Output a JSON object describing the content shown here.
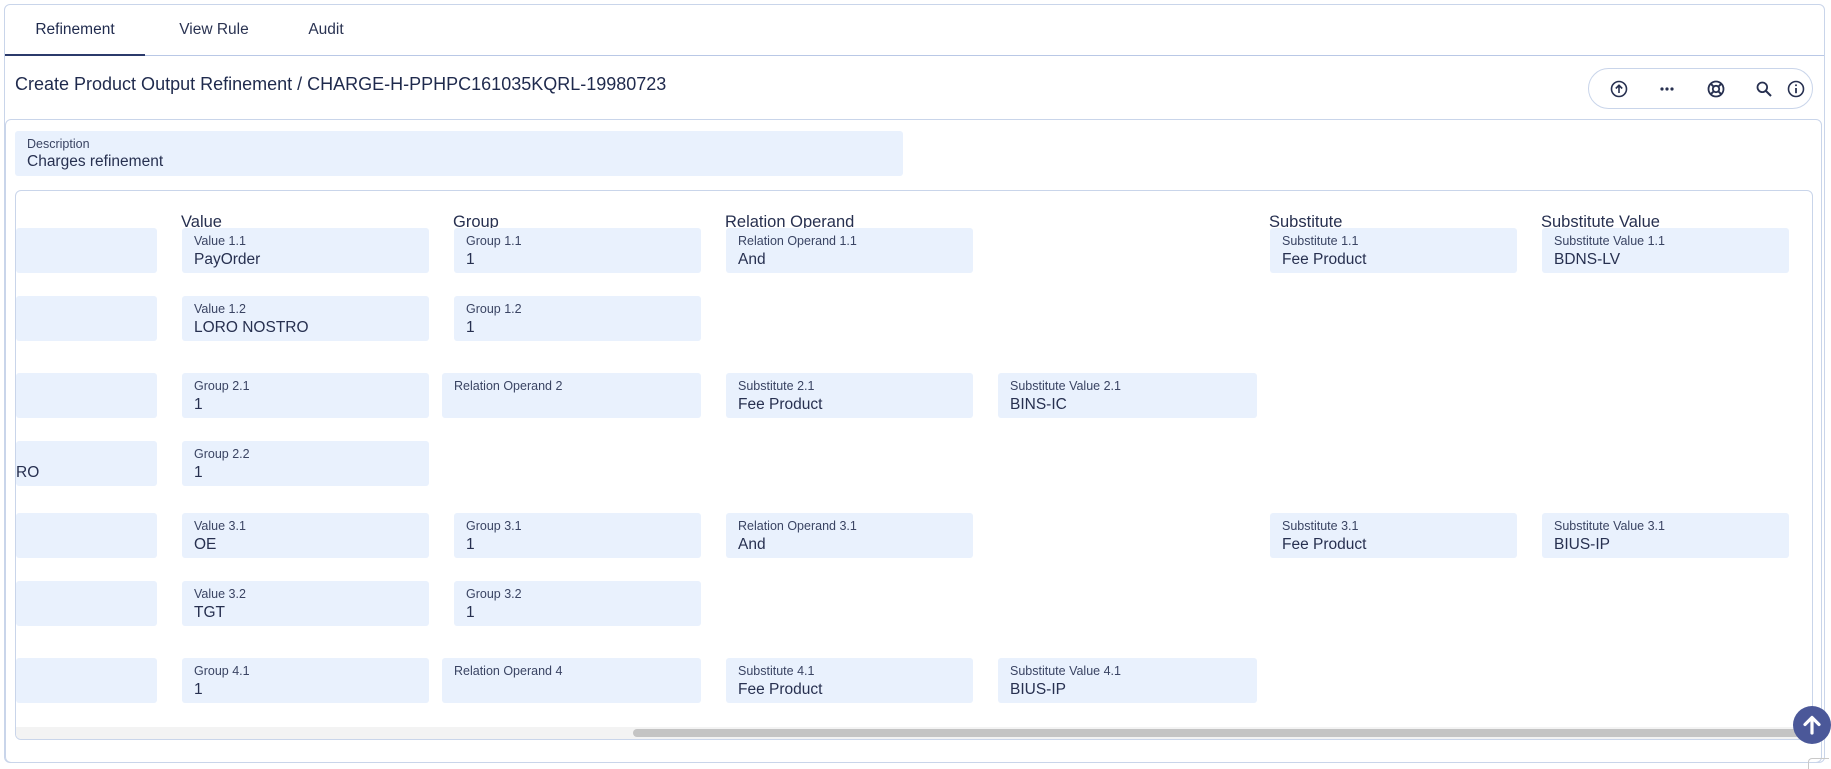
{
  "tabs": [
    {
      "label": "Refinement",
      "active": true
    },
    {
      "label": "View Rule",
      "active": false
    },
    {
      "label": "Audit",
      "active": false
    }
  ],
  "page": {
    "title": "Create Product Output Refinement / CHARGE-H-PPHPC161035KQRL-19980723"
  },
  "toolbar": {
    "icons": [
      "arrow-up-circle-icon",
      "more-horizontal-icon",
      "lifebuoy-icon",
      "search-icon",
      "info-icon"
    ]
  },
  "description": {
    "label": "Description",
    "value": "Charges refinement"
  },
  "grid": {
    "headers": {
      "value": "Value",
      "group": "Group",
      "relation_operand": "Relation Operand",
      "substitute": "Substitute",
      "substitute_value": "Substitute Value"
    },
    "cells": {
      "r1": {
        "value": {
          "label": "Value 1.1",
          "value": "PayOrder"
        },
        "group": {
          "label": "Group 1.1",
          "value": "1"
        },
        "relop": {
          "label": "Relation Operand 1.1",
          "value": "And"
        },
        "sub": {
          "label": "Substitute 1.1",
          "value": "Fee Product"
        },
        "subval": {
          "label": "Substitute Value 1.1",
          "value": "BDNS-LV"
        }
      },
      "r2": {
        "value": {
          "label": "Value 1.2",
          "value": "LORO NOSTRO"
        },
        "group": {
          "label": "Group 1.2",
          "value": "1"
        }
      },
      "r3": {
        "group": {
          "label": "Group 2.1",
          "value": "1"
        },
        "relop": {
          "label": "Relation Operand 2",
          "value": ""
        },
        "sub": {
          "label": "Substitute 2.1",
          "value": "Fee Product"
        },
        "subval": {
          "label": "Substitute Value 2.1",
          "value": "BINS-IC"
        }
      },
      "r4": {
        "partial": {
          "value": "RO"
        },
        "group": {
          "label": "Group 2.2",
          "value": "1"
        }
      },
      "r5": {
        "value": {
          "label": "Value 3.1",
          "value": "OE"
        },
        "group": {
          "label": "Group 3.1",
          "value": "1"
        },
        "relop": {
          "label": "Relation Operand 3.1",
          "value": "And"
        },
        "sub": {
          "label": "Substitute 3.1",
          "value": "Fee Product"
        },
        "subval": {
          "label": "Substitute Value 3.1",
          "value": "BIUS-IP"
        }
      },
      "r6": {
        "value": {
          "label": "Value 3.2",
          "value": "TGT"
        },
        "group": {
          "label": "Group 3.2",
          "value": "1"
        }
      },
      "r7": {
        "group": {
          "label": "Group 4.1",
          "value": "1"
        },
        "relop": {
          "label": "Relation Operand 4",
          "value": ""
        },
        "sub": {
          "label": "Substitute 4.1",
          "value": "Fee Product"
        },
        "subval": {
          "label": "Substitute Value 4.1",
          "value": "BIUS-IP"
        }
      }
    }
  },
  "colors": {
    "accent": "#2b3a6b",
    "field_bg": "#e9f1fd",
    "border": "#c9d5ea",
    "fab": "#4b5899"
  }
}
